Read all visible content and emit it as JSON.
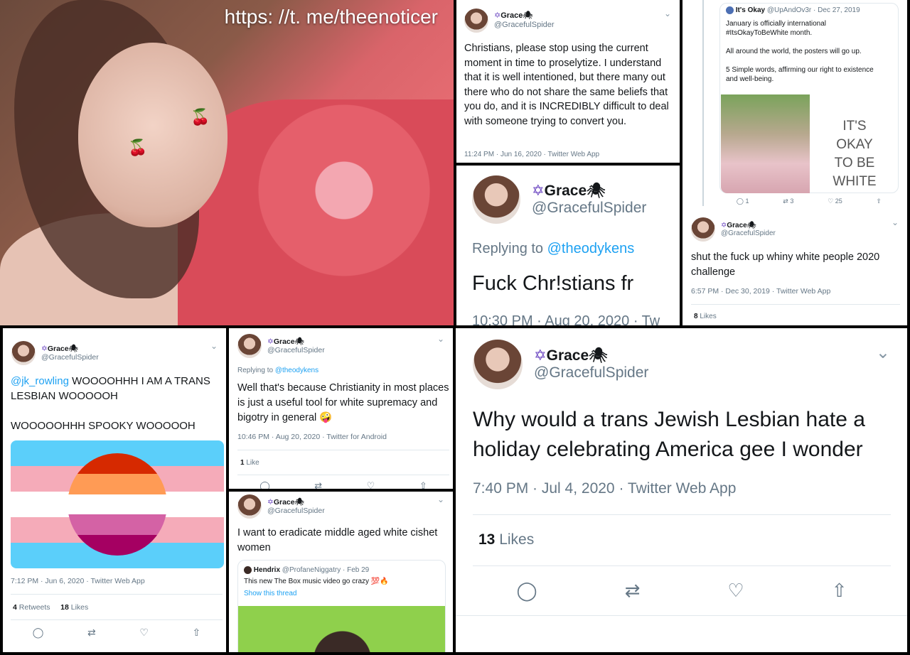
{
  "photo": {
    "caption": "https: //t. me/theenoticer"
  },
  "author": {
    "name": "Grace",
    "handle": "@GracefulSpider",
    "star_glyph": "✡",
    "spider_glyph": "🕷"
  },
  "tweet_proselytize": {
    "text": "Christians, please stop using the current moment in time to proselytize. I understand that it is well intentioned, but there many out there who do not share the same beliefs that you do, and it is INCREDIBLY difficult to deal with someone trying to convert you.",
    "meta": "11:24 PM · Jun 16, 2020 · Twitter Web App"
  },
  "tweet_fuck": {
    "replying_label": "Replying to",
    "replying_to": "@theodykens",
    "text": "Fuck Chr!stians fr",
    "meta": "10:30 PM · Aug 20, 2020 · Tw"
  },
  "tweet_itsokay": {
    "quoted_name": "It's Okay",
    "quoted_handle": "@UpAndOv3r · Dec 27, 2019",
    "line1": "January is officially international",
    "line2": "#ItsOkayToBeWhite month.",
    "line3": "All around the world, the posters will go up.",
    "line4": "5 Simple words, affirming our right to existence",
    "line5": "and well-being.",
    "poster_lines": [
      "IT'S",
      "OKAY",
      "TO BE",
      "WHITE"
    ],
    "counts": [
      "1",
      "3",
      "25"
    ],
    "reply_text": "shut the fuck up whiny white people 2020 challenge",
    "meta": "6:57 PM · Dec 30, 2019 · Twitter Web App",
    "likes_count": "8",
    "likes_label": "Likes"
  },
  "tweet_jk": {
    "mention": "@jk_rowling",
    "text1": " WOOOOHHH I AM A TRANS LESBIAN WOOOOOH",
    "text2": "WOOOOOHHH SPOOKY WOOOOOH",
    "meta": "7:12 PM · Jun 6, 2020 · Twitter Web App",
    "retweets_count": "4",
    "retweets_label": "Retweets",
    "likes_count": "18",
    "likes_label": "Likes",
    "colors": {
      "blue": "#5bcffa",
      "pink": "#f5abb9",
      "white": "#ffffff",
      "sun": [
        "#d62900",
        "#ff9b55",
        "#ffffff",
        "#d462a5",
        "#a50062"
      ]
    }
  },
  "tweet_christianity": {
    "replying_label": "Replying to",
    "replying_to": "@theodykens",
    "text": "Well that's because Christianity in most places is just a useful tool for white supremacy and bigotry in general 🤪",
    "meta": "10:46 PM · Aug 20, 2020 · Twitter for Android",
    "likes_count": "1",
    "likes_label": "Like"
  },
  "tweet_eradicate": {
    "text": "I want to eradicate middle aged white cishet women",
    "quoted_name": "Hendrix",
    "quoted_handle": "@ProfaneNiggatry · Feb 29",
    "quoted_text": "This new The Box music video go crazy 💯🔥",
    "quoted_link": "Show this thread"
  },
  "tweet_holiday": {
    "text": "Why would a trans Jewish Lesbian hate a holiday celebrating America gee I wonder",
    "meta": "7:40 PM · Jul 4, 2020 · Twitter Web App",
    "likes_count": "13",
    "likes_label": "Likes"
  },
  "icons": {
    "reply": "reply-icon",
    "retweet": "retweet-icon",
    "like": "heart-icon",
    "share": "share-icon",
    "chevron": "chevron-down-icon"
  }
}
